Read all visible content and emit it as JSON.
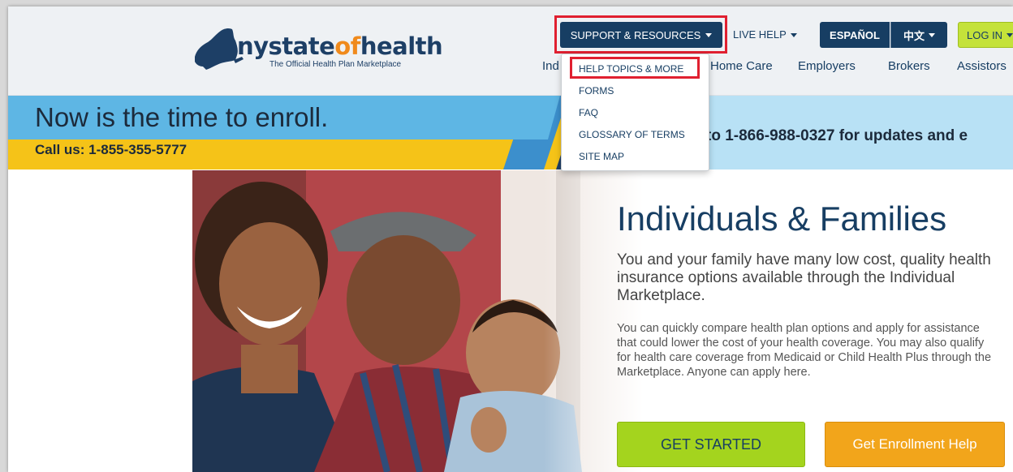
{
  "logo": {
    "name_part1": "nystate",
    "name_part2": "of",
    "name_part3": "health",
    "tagline": "The Official Health Plan Marketplace"
  },
  "topbar": {
    "support_label": "SUPPORT & RESOURCES",
    "live_help_label": "LIVE HELP",
    "espanol_label": "ESPAÑOL",
    "chinese_label": "中文",
    "login_label": "LOG IN"
  },
  "nav": {
    "items": [
      {
        "label": "Ind"
      },
      {
        "label": "Home Care"
      },
      {
        "label": "Employers"
      },
      {
        "label": "Brokers"
      },
      {
        "label": "Assistors"
      }
    ]
  },
  "dropdown": {
    "items": [
      {
        "label": "HELP TOPICS & MORE"
      },
      {
        "label": "FORMS"
      },
      {
        "label": "FAQ"
      },
      {
        "label": "GLOSSARY OF TERMS"
      },
      {
        "label": "SITE MAP"
      }
    ]
  },
  "banner": {
    "title": "Now is the time to enroll.",
    "call": "Call us: 1-855-355-5777",
    "right_text": "to 1-866-988-0327 for updates and e"
  },
  "main": {
    "heading": "Individuals & Families",
    "lead": "You and your family have many low cost, quality health insurance options available through the Individual Marketplace.",
    "body": "You can quickly compare health plan options and apply for assistance that could lower the cost of your health coverage. You may also qualify for health care coverage from Medicaid or Child Health Plus through the Marketplace. Anyone can apply here.",
    "get_started_label": "GET STARTED",
    "enrollment_help_label": "Get Enrollment Help"
  },
  "icons": {
    "logo_map": "new-york-state-map-icon",
    "caret": "chevron-down-icon"
  },
  "colors": {
    "brand_navy": "#173e63",
    "brand_orange": "#f08a1c",
    "highlight_red": "#e02030",
    "start_green": "#a4d41e",
    "enroll_orange": "#f2a51b",
    "banner_blue": "#5eb6e4",
    "banner_yellow": "#f5c318"
  }
}
